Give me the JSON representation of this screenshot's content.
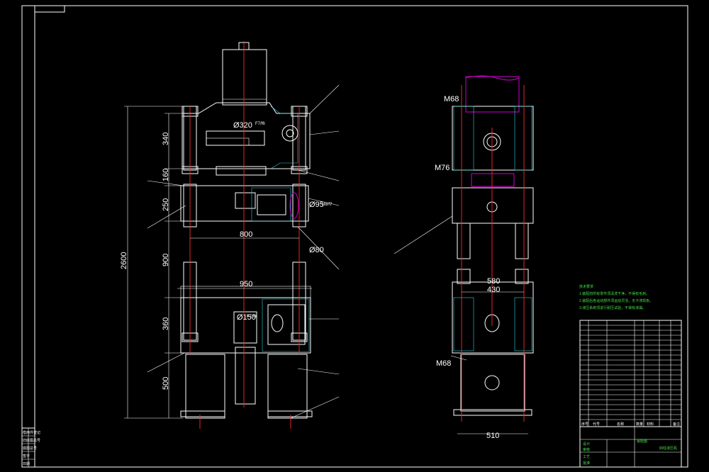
{
  "front_view": {
    "dims": {
      "overall_height": "2600",
      "seg_340": "340",
      "seg_160": "160",
      "seg_250": "250",
      "seg_900": "900",
      "seg_360": "360",
      "seg_500": "500",
      "width_800": "800",
      "width_950": "950",
      "bore_top": "Ø320",
      "bore_top_fit": "F7/f6",
      "bore_mid": "Ø95",
      "bore_rod": "Ø80",
      "bore_mid_fit": "H8/f7",
      "bore_bottom": "Ø150",
      "bore_bottom_fit": "F7/f6"
    }
  },
  "side_view": {
    "dims": {
      "thread_top": "M68",
      "thread_mid": "M76",
      "thread_bottom": "M68",
      "width_580": "580",
      "width_430": "430",
      "width_510": "510"
    }
  },
  "technical_requirements": {
    "title": "技术要求",
    "lines": [
      "1.装配前所有零件须清洗干净，不得有毛刺。",
      "2.装配后各运动部件须运动灵活，无卡滞现象。",
      "3.液压系统须进行耐压试验，不得有渗漏。"
    ]
  },
  "title_block": {
    "drawing_title": "装配图",
    "designation": "四柱液压机",
    "header_labels": [
      "序号",
      "代号",
      "名称",
      "数量",
      "材料",
      "备注"
    ],
    "bottom_labels": [
      "设计",
      "审核",
      "工艺",
      "批准"
    ]
  },
  "left_margin_block": {
    "labels": [
      "借用件登记",
      "旧底图总号",
      "底图总号",
      "签字",
      "日期"
    ]
  }
}
